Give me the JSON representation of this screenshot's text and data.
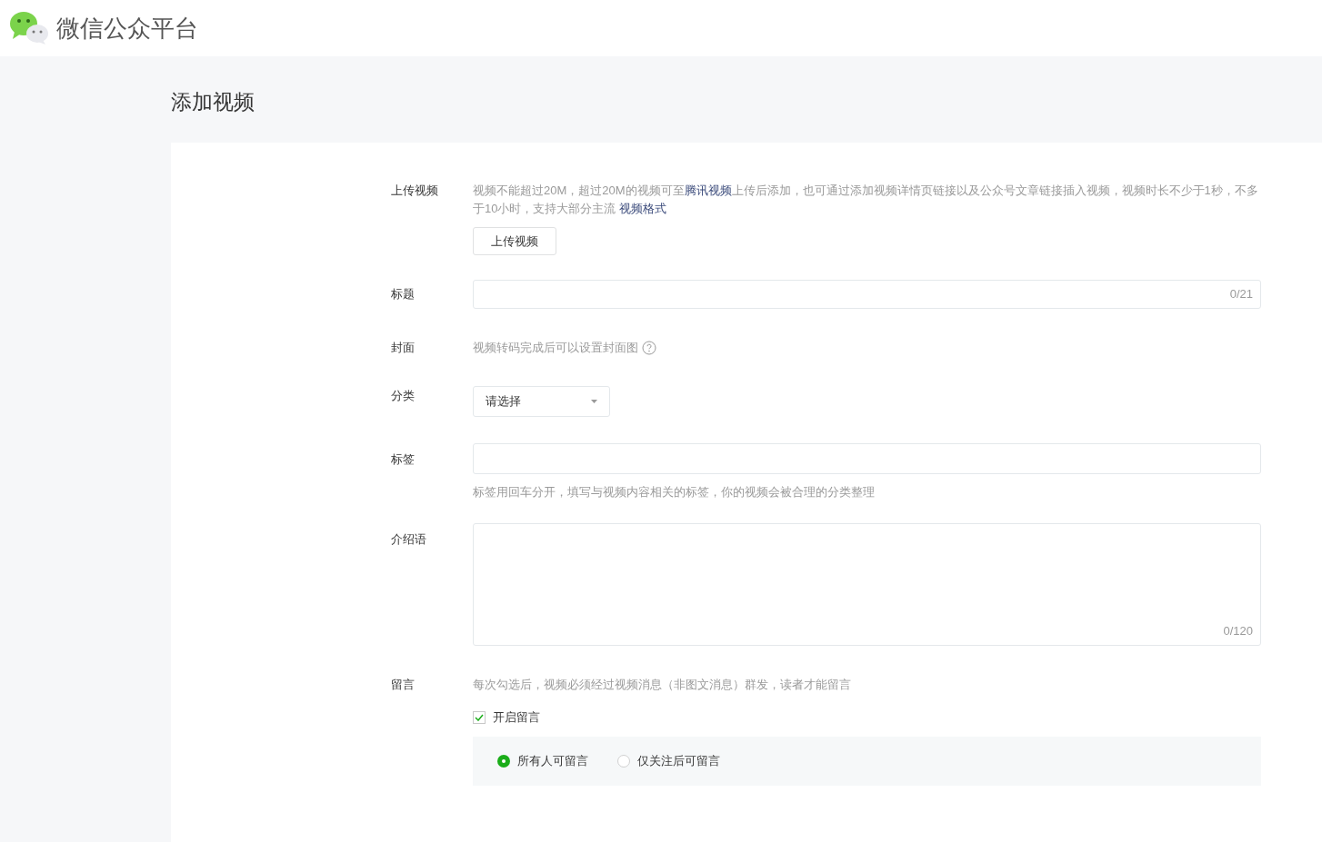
{
  "header": {
    "brand": "微信公众平台"
  },
  "page_title": "添加视频",
  "upload": {
    "label": "上传视频",
    "description": [
      {
        "kind": "plain",
        "text": "视频不能超过20M，超过20M的视频可至"
      },
      {
        "kind": "link",
        "text": "腾讯视频"
      },
      {
        "kind": "plain",
        "text": "上传后添加，也可通过添加视频详情页链接以及公众号文章链接插入视频，视频时长不少于1秒，不多于10小时，支持大部分主流 "
      },
      {
        "kind": "link",
        "text": "视频格式"
      }
    ],
    "button": "上传视频"
  },
  "title_field": {
    "label": "标题",
    "counter": "0/21"
  },
  "cover": {
    "label": "封面",
    "hint": "视频转码完成后可以设置封面图"
  },
  "category": {
    "label": "分类",
    "value": "请选择"
  },
  "tags": {
    "label": "标签",
    "hint": "标签用回车分开，填写与视频内容相关的标签，你的视频会被合理的分类整理"
  },
  "intro": {
    "label": "介绍语",
    "counter": "0/120"
  },
  "comments": {
    "label": "留言",
    "hint": "每次勾选后，视频必须经过视频消息（非图文消息）群发，读者才能留言",
    "enable": {
      "label": "开启留言",
      "checked": true
    },
    "options": [
      {
        "label": "所有人可留言",
        "selected": true
      },
      {
        "label": "仅关注后可留言",
        "selected": false
      }
    ]
  }
}
